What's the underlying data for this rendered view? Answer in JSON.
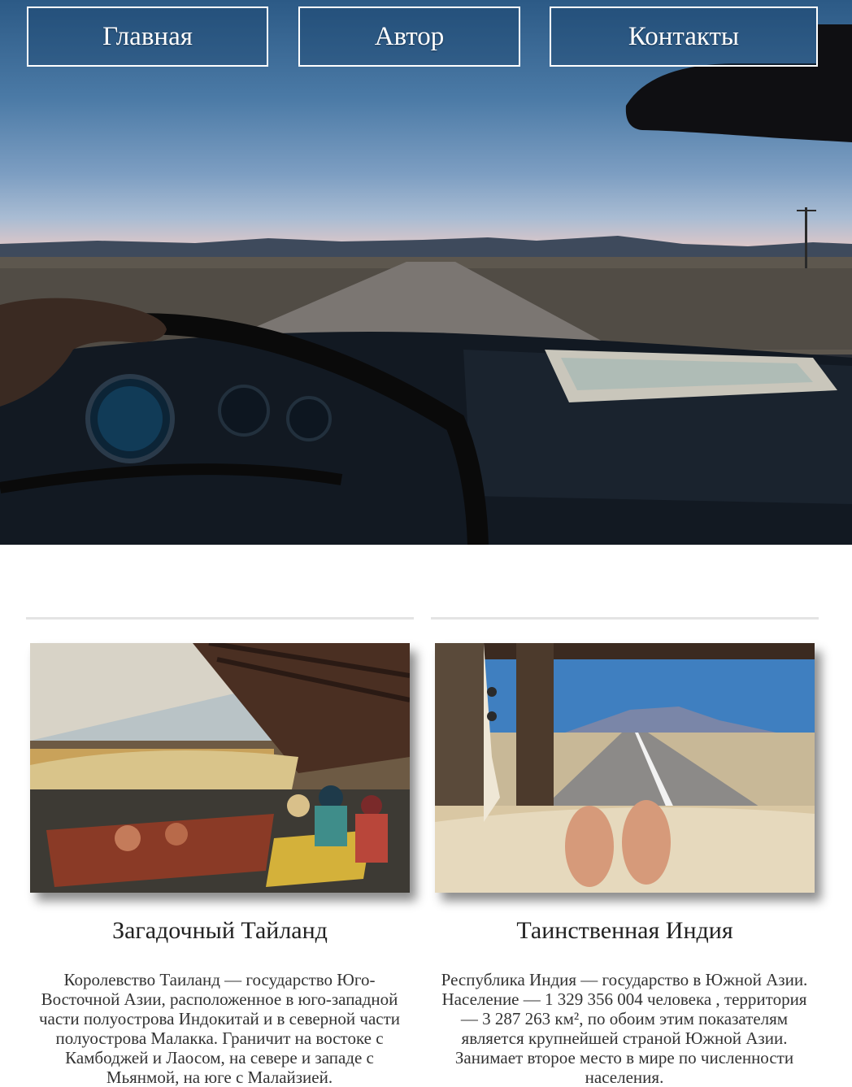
{
  "nav": {
    "items": [
      {
        "label": "Главная"
      },
      {
        "label": "Автор"
      },
      {
        "label": "Контакты"
      }
    ]
  },
  "cards": [
    {
      "title": "Загадочный Тайланд",
      "text": "Королевство Таиланд — государство Юго-Восточной Азии, расположенное в юго-западной части полуострова Индокитай и в северной части полуострова Малакка. Граничит на востоке с Камбоджей и Лаосом, на севере и западе с Мьянмой, на юге с Малайзией."
    },
    {
      "title": "Таинственная Индия",
      "text": "Республика Индия — государство в Южной Азии. Население — 1 329 356 004 человека , территория — 3 287 263 км², по обоим этим показателям является крупнейшей страной Южной Азии. Занимает второе место в мире по численности населения."
    }
  ],
  "colors": {
    "nav_border": "#ffffff",
    "divider": "#e4e4e4"
  }
}
